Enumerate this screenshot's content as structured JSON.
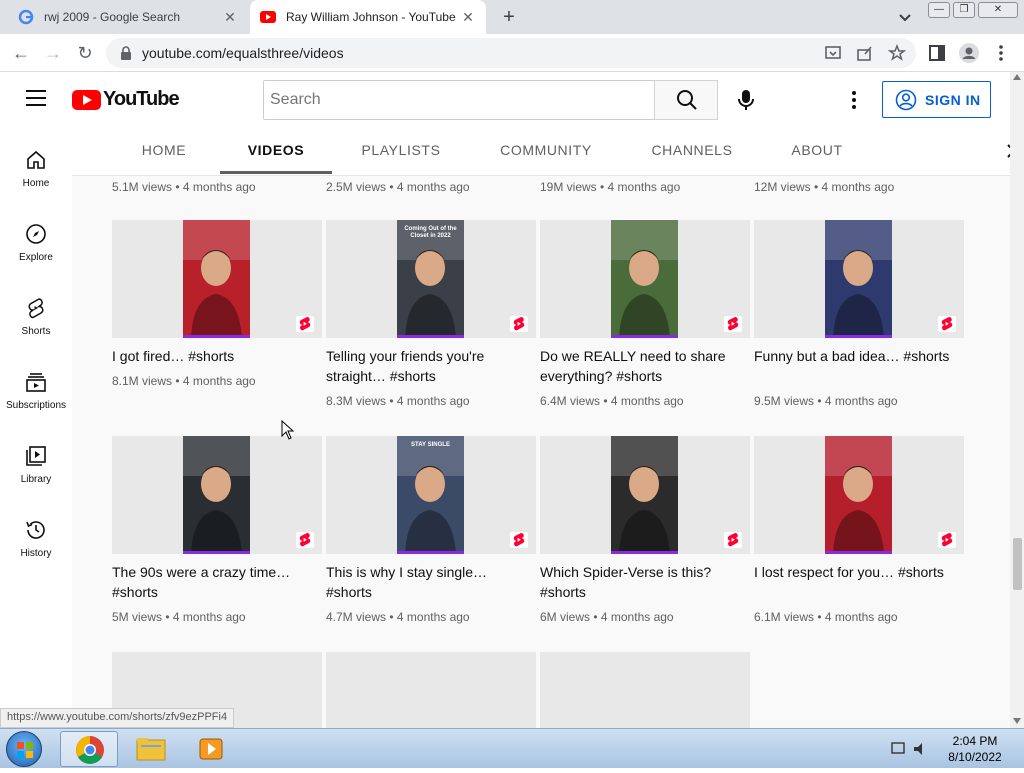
{
  "browser": {
    "tabs": [
      {
        "title": "rwj 2009 - Google Search",
        "active": false
      },
      {
        "title": "Ray William Johnson - YouTube",
        "active": true
      }
    ],
    "url": "youtube.com/equalsthree/videos",
    "status_url": "https://www.youtube.com/shorts/zfv9ezPPFi4"
  },
  "masthead": {
    "logo_text": "YouTube",
    "search_placeholder": "Search",
    "signin_label": "SIGN IN"
  },
  "channel_tabs": [
    "HOME",
    "VIDEOS",
    "PLAYLISTS",
    "COMMUNITY",
    "CHANNELS",
    "ABOUT"
  ],
  "selected_tab": "VIDEOS",
  "sidebar": [
    {
      "label": "Home",
      "icon": "home-icon"
    },
    {
      "label": "Explore",
      "icon": "explore-icon"
    },
    {
      "label": "Shorts",
      "icon": "shorts-icon"
    },
    {
      "label": "Subscriptions",
      "icon": "subscriptions-icon"
    },
    {
      "label": "Library",
      "icon": "library-icon"
    },
    {
      "label": "History",
      "icon": "history-icon"
    }
  ],
  "top_row_meta": [
    "5.1M views • 4 months ago",
    "2.5M views • 4 months ago",
    "19M views • 4 months ago",
    "12M views • 4 months ago"
  ],
  "videos": [
    {
      "title": "I got fired… #shorts",
      "meta": "8.1M views • 4 months ago",
      "thumb_bg": "#b8202a",
      "thumb_caption": ""
    },
    {
      "title": "Telling your friends you're straight… #shorts",
      "meta": "8.3M views • 4 months ago",
      "thumb_bg": "#3a3f48",
      "thumb_caption": "Coming Out of the Closet in 2022"
    },
    {
      "title": "Do we REALLY need to share everything? #shorts",
      "meta": "6.4M views • 4 months ago",
      "thumb_bg": "#4a6b3a",
      "thumb_caption": ""
    },
    {
      "title": "Funny but a bad idea… #shorts",
      "meta": "9.5M views • 4 months ago",
      "thumb_bg": "#2e3a6e",
      "thumb_caption": ""
    },
    {
      "title": "The 90s were a crazy time… #shorts",
      "meta": "5M views • 4 months ago",
      "thumb_bg": "#2a2e33",
      "thumb_caption": ""
    },
    {
      "title": "This is why I stay single… #shorts",
      "meta": "4.7M views • 4 months ago",
      "thumb_bg": "#3b4a66",
      "thumb_caption": "STAY SINGLE"
    },
    {
      "title": "Which Spider-Verse is this? #shorts",
      "meta": "6M views • 4 months ago",
      "thumb_bg": "#2b2b2b",
      "thumb_caption": ""
    },
    {
      "title": "I lost respect for you… #shorts",
      "meta": "6.1M views • 4 months ago",
      "thumb_bg": "#b51f2c",
      "thumb_caption": ""
    }
  ],
  "taskbar": {
    "time": "2:04 PM",
    "date": "8/10/2022"
  },
  "colors": {
    "youtube_red": "#ff0000",
    "link_blue": "#065fd4",
    "shorts_red": "#ff0033"
  }
}
